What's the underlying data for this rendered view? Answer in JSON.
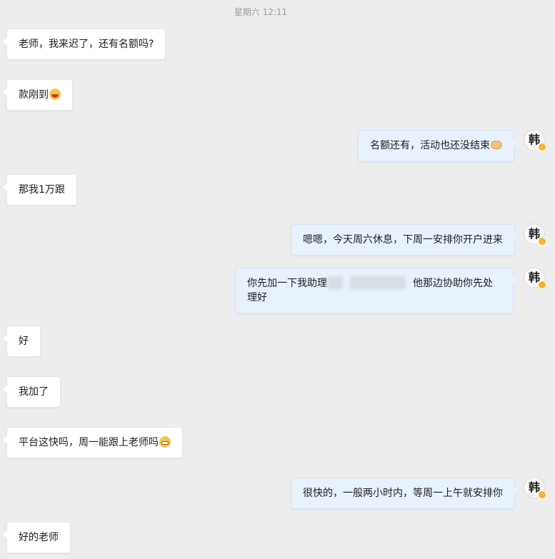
{
  "timestamp": "星期六 12:11",
  "avatar": {
    "glyph": "韩",
    "badge_color": "#f3b62a"
  },
  "messages": [
    {
      "side": "left",
      "text": "老师，我来迟了，还有名额吗?"
    },
    {
      "side": "left",
      "text": "款刚到",
      "emoji": "laughing-crying-emoji"
    },
    {
      "side": "right",
      "text": "名额还有，活动也还没结束",
      "emoji": "handshake-emoji"
    },
    {
      "side": "left",
      "text": "那我1万跟"
    },
    {
      "side": "right",
      "text": "嗯嗯，今天周六休息，下周一安排你开户进来"
    },
    {
      "side": "right",
      "text_before": "你先加一下我助理",
      "text_after": "他那边协助你先处",
      "text_line2": "理好"
    },
    {
      "side": "left",
      "text": "好"
    },
    {
      "side": "left",
      "text": "我加了"
    },
    {
      "side": "left",
      "text": "平台这快吗，周一能跟上老师吗",
      "emoji": "grinning-teeth-emoji"
    },
    {
      "side": "right",
      "text": "很快的，一般两小时内，等周一上午就安排你"
    },
    {
      "side": "left",
      "text": "好的老师"
    }
  ],
  "colors": {
    "background": "#ededed",
    "left_bubble": "#ffffff",
    "right_bubble": "#e7f2fd"
  }
}
